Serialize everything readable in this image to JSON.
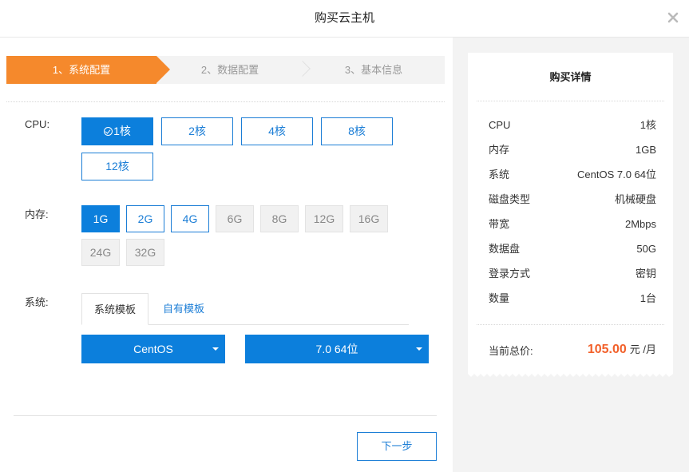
{
  "dialog": {
    "title": "购买云主机"
  },
  "steps": [
    {
      "label": "1、系统配置"
    },
    {
      "label": "2、数据配置"
    },
    {
      "label": "3、基本信息"
    }
  ],
  "cpu": {
    "label": "CPU:",
    "options": [
      "1核",
      "2核",
      "4核",
      "8核",
      "12核"
    ],
    "selected": "1核"
  },
  "memory": {
    "label": "内存:",
    "options": [
      "1G",
      "2G",
      "4G",
      "6G",
      "8G",
      "12G",
      "16G",
      "24G",
      "32G"
    ],
    "selected": "1G",
    "available": [
      "1G",
      "2G",
      "4G"
    ]
  },
  "system": {
    "label": "系统:",
    "tabs": [
      "系统模板",
      "自有模板"
    ],
    "active_tab": "系统模板",
    "os_select": "CentOS",
    "version_select": "7.0 64位"
  },
  "footer": {
    "next_label": "下一步"
  },
  "summary": {
    "title": "购买详情",
    "rows": [
      {
        "key": "CPU",
        "value": "1核"
      },
      {
        "key": "内存",
        "value": "1GB"
      },
      {
        "key": "系统",
        "value": "CentOS 7.0 64位"
      },
      {
        "key": "磁盘类型",
        "value": "机械硬盘"
      },
      {
        "key": "带宽",
        "value": "2Mbps"
      },
      {
        "key": "数据盘",
        "value": "50G"
      },
      {
        "key": "登录方式",
        "value": "密钥"
      },
      {
        "key": "数量",
        "value": "1台"
      }
    ],
    "total_label": "当前总价:",
    "total_amount": "105.00",
    "total_unit": "元 /月"
  },
  "colors": {
    "accent_orange": "#f5892c",
    "primary_blue": "#0c7fdc",
    "price_red": "#f2612b"
  }
}
